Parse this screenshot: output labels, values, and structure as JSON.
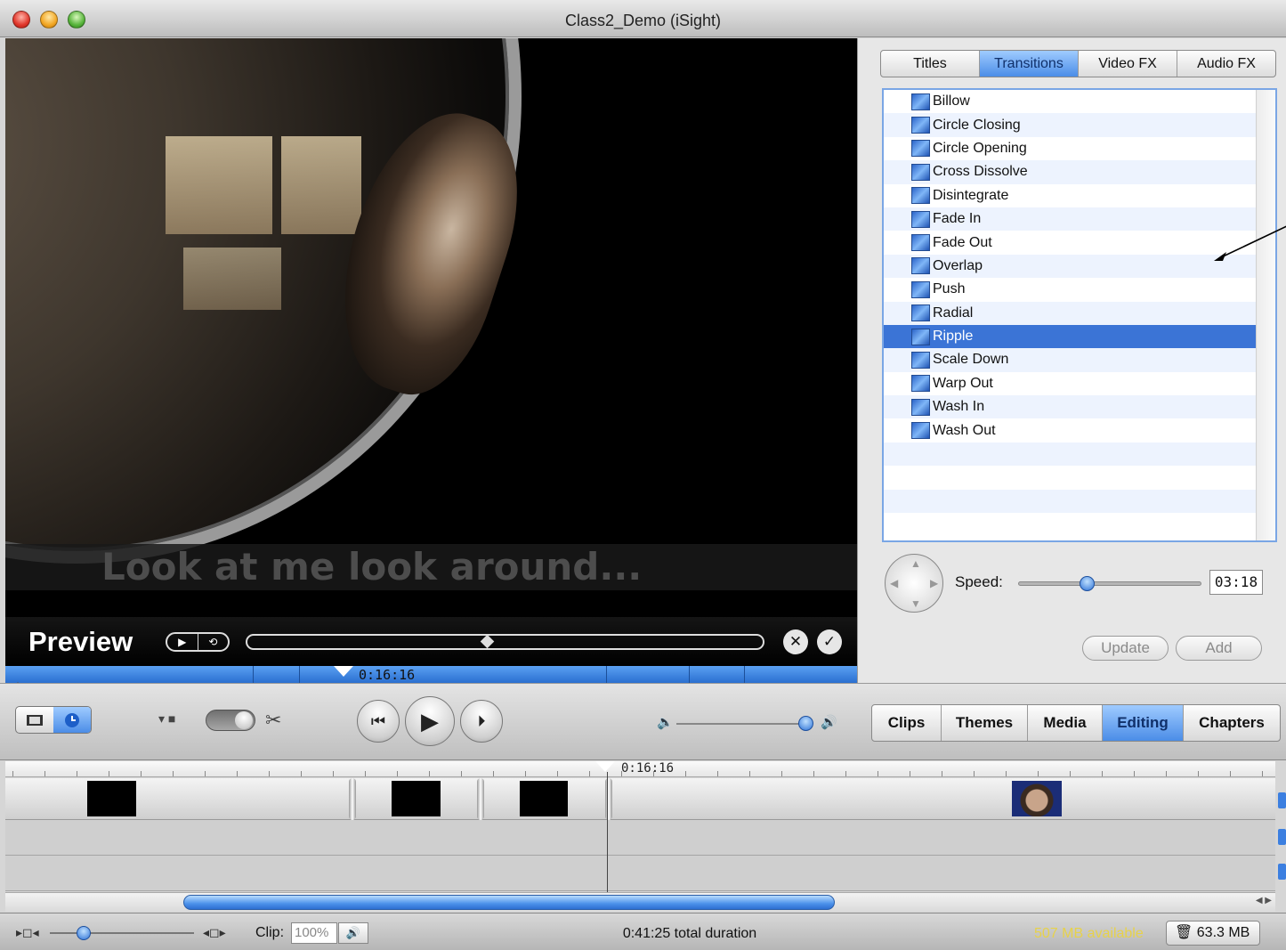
{
  "window": {
    "title": "Class2_Demo (iSight)"
  },
  "viewer": {
    "overlay_text": "Look at me look around...",
    "preview_label": "Preview",
    "playhead_time": "0:16:16"
  },
  "effects_panel": {
    "tabs": [
      {
        "label": "Titles",
        "active": false
      },
      {
        "label": "Transitions",
        "active": true
      },
      {
        "label": "Video FX",
        "active": false
      },
      {
        "label": "Audio FX",
        "active": false
      }
    ],
    "transitions": [
      "Billow",
      "Circle Closing",
      "Circle Opening",
      "Cross Dissolve",
      "Disintegrate",
      "Fade In",
      "Fade Out",
      "Overlap",
      "Push",
      "Radial",
      "Ripple",
      "Scale Down",
      "Warp Out",
      "Wash In",
      "Wash Out"
    ],
    "selected_transition": "Ripple",
    "speed_label": "Speed:",
    "speed_value": "03:18",
    "speed_fraction": 0.37,
    "update_label": "Update",
    "add_label": "Add"
  },
  "pane_buttons": [
    {
      "label": "Clips",
      "active": false
    },
    {
      "label": "Themes",
      "active": false
    },
    {
      "label": "Media",
      "active": false
    },
    {
      "label": "Editing",
      "active": true
    },
    {
      "label": "Chapters",
      "active": false
    }
  ],
  "timeline": {
    "playhead_time": "0:16:16"
  },
  "statusbar": {
    "clip_label": "Clip:",
    "clip_volume": "100%",
    "total_duration": "0:41:25 total duration",
    "available": "507 MB available",
    "trash_size": "63.3 MB"
  },
  "colors": {
    "accent": "#4b8de7",
    "selection": "#3b74d6",
    "available_text": "#e7d24a"
  }
}
